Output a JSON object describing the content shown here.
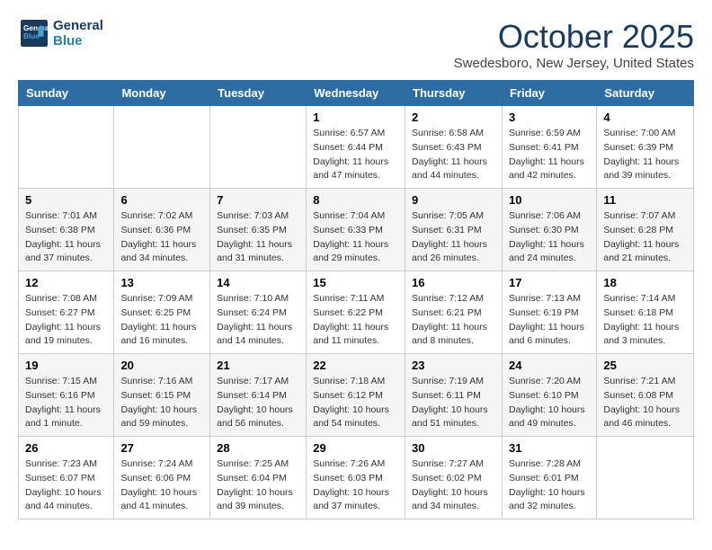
{
  "logo": {
    "line1": "General",
    "line2": "Blue"
  },
  "title": "October 2025",
  "location": "Swedesboro, New Jersey, United States",
  "days_of_week": [
    "Sunday",
    "Monday",
    "Tuesday",
    "Wednesday",
    "Thursday",
    "Friday",
    "Saturday"
  ],
  "weeks": [
    [
      {
        "day": "",
        "info": ""
      },
      {
        "day": "",
        "info": ""
      },
      {
        "day": "",
        "info": ""
      },
      {
        "day": "1",
        "info": "Sunrise: 6:57 AM\nSunset: 6:44 PM\nDaylight: 11 hours\nand 47 minutes."
      },
      {
        "day": "2",
        "info": "Sunrise: 6:58 AM\nSunset: 6:43 PM\nDaylight: 11 hours\nand 44 minutes."
      },
      {
        "day": "3",
        "info": "Sunrise: 6:59 AM\nSunset: 6:41 PM\nDaylight: 11 hours\nand 42 minutes."
      },
      {
        "day": "4",
        "info": "Sunrise: 7:00 AM\nSunset: 6:39 PM\nDaylight: 11 hours\nand 39 minutes."
      }
    ],
    [
      {
        "day": "5",
        "info": "Sunrise: 7:01 AM\nSunset: 6:38 PM\nDaylight: 11 hours\nand 37 minutes."
      },
      {
        "day": "6",
        "info": "Sunrise: 7:02 AM\nSunset: 6:36 PM\nDaylight: 11 hours\nand 34 minutes."
      },
      {
        "day": "7",
        "info": "Sunrise: 7:03 AM\nSunset: 6:35 PM\nDaylight: 11 hours\nand 31 minutes."
      },
      {
        "day": "8",
        "info": "Sunrise: 7:04 AM\nSunset: 6:33 PM\nDaylight: 11 hours\nand 29 minutes."
      },
      {
        "day": "9",
        "info": "Sunrise: 7:05 AM\nSunset: 6:31 PM\nDaylight: 11 hours\nand 26 minutes."
      },
      {
        "day": "10",
        "info": "Sunrise: 7:06 AM\nSunset: 6:30 PM\nDaylight: 11 hours\nand 24 minutes."
      },
      {
        "day": "11",
        "info": "Sunrise: 7:07 AM\nSunset: 6:28 PM\nDaylight: 11 hours\nand 21 minutes."
      }
    ],
    [
      {
        "day": "12",
        "info": "Sunrise: 7:08 AM\nSunset: 6:27 PM\nDaylight: 11 hours\nand 19 minutes."
      },
      {
        "day": "13",
        "info": "Sunrise: 7:09 AM\nSunset: 6:25 PM\nDaylight: 11 hours\nand 16 minutes."
      },
      {
        "day": "14",
        "info": "Sunrise: 7:10 AM\nSunset: 6:24 PM\nDaylight: 11 hours\nand 14 minutes."
      },
      {
        "day": "15",
        "info": "Sunrise: 7:11 AM\nSunset: 6:22 PM\nDaylight: 11 hours\nand 11 minutes."
      },
      {
        "day": "16",
        "info": "Sunrise: 7:12 AM\nSunset: 6:21 PM\nDaylight: 11 hours\nand 8 minutes."
      },
      {
        "day": "17",
        "info": "Sunrise: 7:13 AM\nSunset: 6:19 PM\nDaylight: 11 hours\nand 6 minutes."
      },
      {
        "day": "18",
        "info": "Sunrise: 7:14 AM\nSunset: 6:18 PM\nDaylight: 11 hours\nand 3 minutes."
      }
    ],
    [
      {
        "day": "19",
        "info": "Sunrise: 7:15 AM\nSunset: 6:16 PM\nDaylight: 11 hours\nand 1 minute."
      },
      {
        "day": "20",
        "info": "Sunrise: 7:16 AM\nSunset: 6:15 PM\nDaylight: 10 hours\nand 59 minutes."
      },
      {
        "day": "21",
        "info": "Sunrise: 7:17 AM\nSunset: 6:14 PM\nDaylight: 10 hours\nand 56 minutes."
      },
      {
        "day": "22",
        "info": "Sunrise: 7:18 AM\nSunset: 6:12 PM\nDaylight: 10 hours\nand 54 minutes."
      },
      {
        "day": "23",
        "info": "Sunrise: 7:19 AM\nSunset: 6:11 PM\nDaylight: 10 hours\nand 51 minutes."
      },
      {
        "day": "24",
        "info": "Sunrise: 7:20 AM\nSunset: 6:10 PM\nDaylight: 10 hours\nand 49 minutes."
      },
      {
        "day": "25",
        "info": "Sunrise: 7:21 AM\nSunset: 6:08 PM\nDaylight: 10 hours\nand 46 minutes."
      }
    ],
    [
      {
        "day": "26",
        "info": "Sunrise: 7:23 AM\nSunset: 6:07 PM\nDaylight: 10 hours\nand 44 minutes."
      },
      {
        "day": "27",
        "info": "Sunrise: 7:24 AM\nSunset: 6:06 PM\nDaylight: 10 hours\nand 41 minutes."
      },
      {
        "day": "28",
        "info": "Sunrise: 7:25 AM\nSunset: 6:04 PM\nDaylight: 10 hours\nand 39 minutes."
      },
      {
        "day": "29",
        "info": "Sunrise: 7:26 AM\nSunset: 6:03 PM\nDaylight: 10 hours\nand 37 minutes."
      },
      {
        "day": "30",
        "info": "Sunrise: 7:27 AM\nSunset: 6:02 PM\nDaylight: 10 hours\nand 34 minutes."
      },
      {
        "day": "31",
        "info": "Sunrise: 7:28 AM\nSunset: 6:01 PM\nDaylight: 10 hours\nand 32 minutes."
      },
      {
        "day": "",
        "info": ""
      }
    ]
  ]
}
